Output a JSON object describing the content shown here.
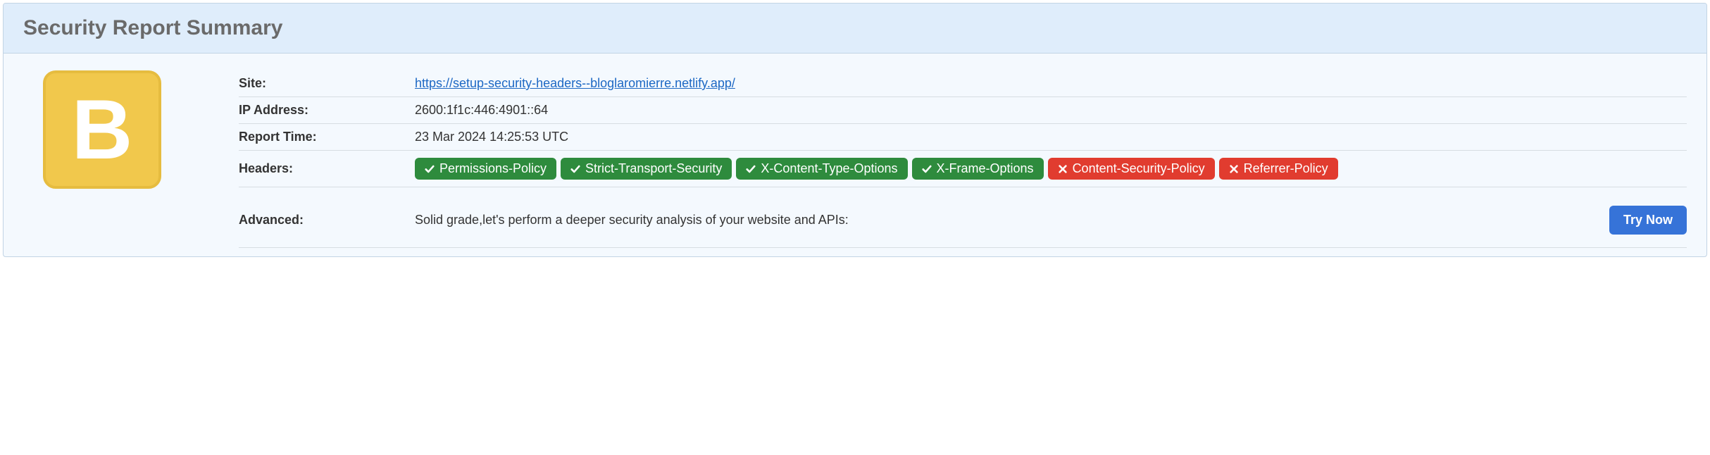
{
  "title": "Security Report Summary",
  "grade": "B",
  "colors": {
    "grade_bg": "#f1c84c",
    "pass": "#2e8b3d",
    "fail": "#e13c2f",
    "btn": "#3673d8"
  },
  "rows": {
    "site": {
      "label": "Site:",
      "value": "https://setup-security-headers--bloglaromierre.netlify.app/"
    },
    "ip": {
      "label": "IP Address:",
      "value": "2600:1f1c:446:4901::64"
    },
    "time": {
      "label": "Report Time:",
      "value": "23 Mar 2024 14:25:53 UTC"
    },
    "headers": {
      "label": "Headers:"
    },
    "advanced": {
      "label": "Advanced:",
      "text": "Solid grade,let's perform a deeper security analysis of your website and APIs:",
      "button": "Try Now"
    }
  },
  "headers_list": [
    {
      "name": "Permissions-Policy",
      "status": "pass"
    },
    {
      "name": "Strict-Transport-Security",
      "status": "pass"
    },
    {
      "name": "X-Content-Type-Options",
      "status": "pass"
    },
    {
      "name": "X-Frame-Options",
      "status": "pass"
    },
    {
      "name": "Content-Security-Policy",
      "status": "fail"
    },
    {
      "name": "Referrer-Policy",
      "status": "fail"
    }
  ]
}
